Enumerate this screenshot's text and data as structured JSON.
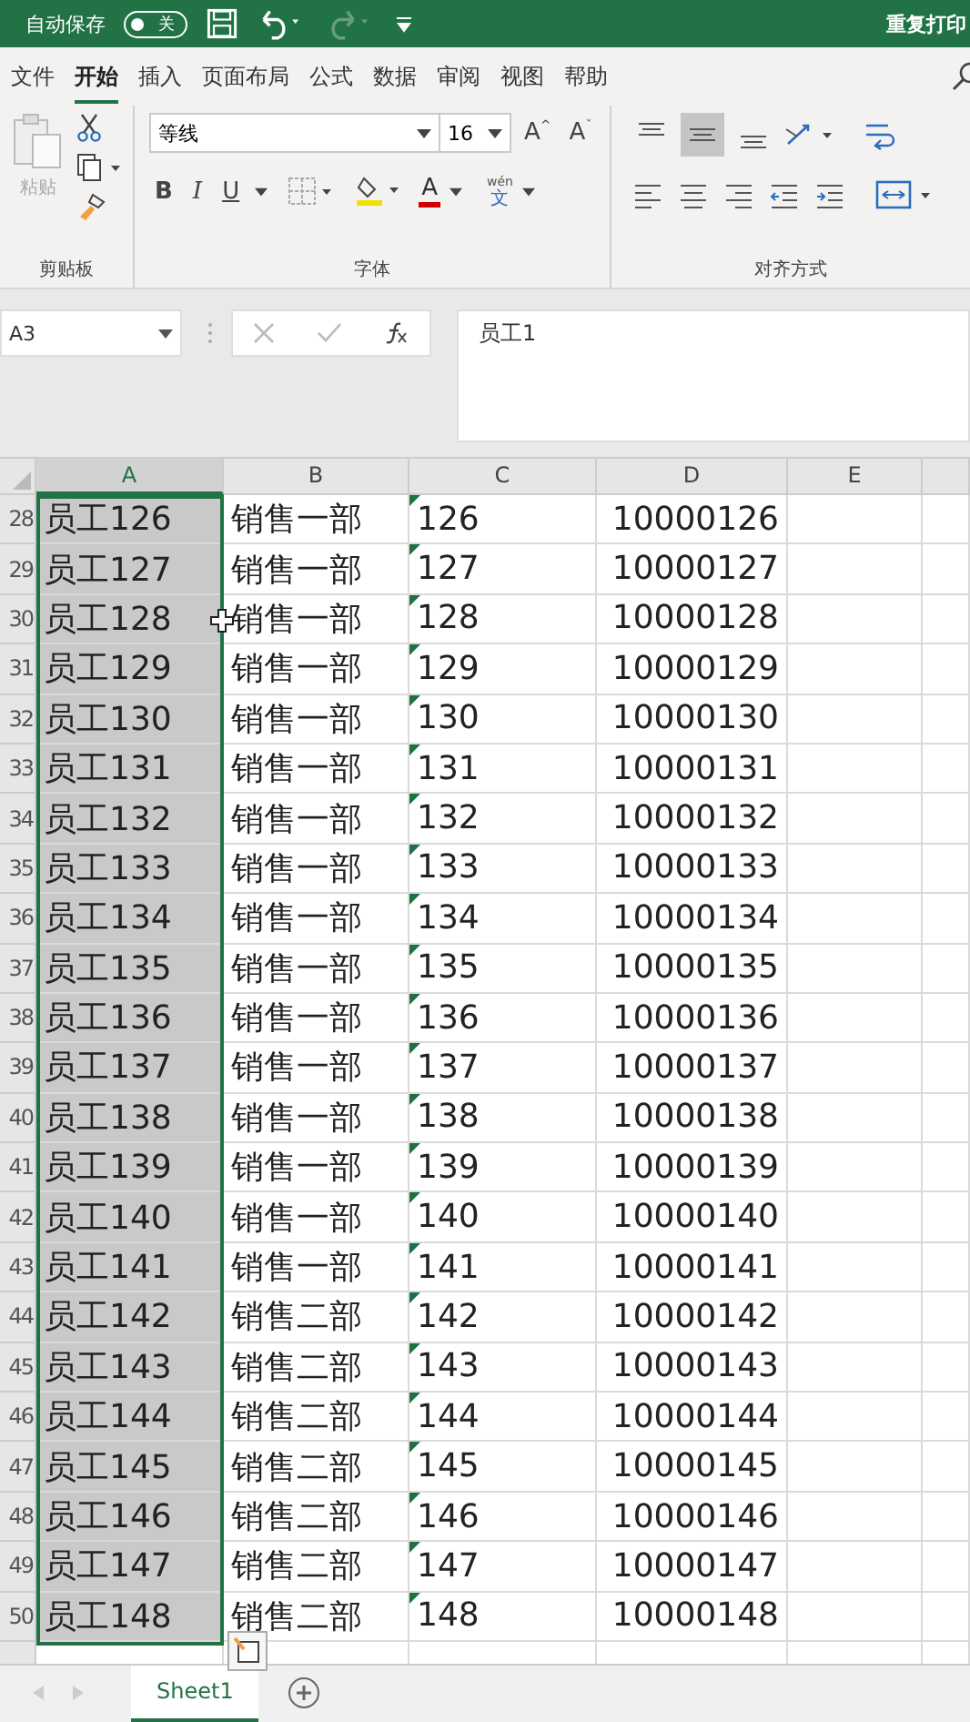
{
  "titlebar": {
    "autosave_label": "自动保存",
    "autosave_on": false,
    "autosave_state": "关",
    "title": "重复打印"
  },
  "tabs": [
    {
      "label": "文件",
      "selected": false
    },
    {
      "label": "开始",
      "selected": true
    },
    {
      "label": "插入",
      "selected": false
    },
    {
      "label": "页面布局",
      "selected": false
    },
    {
      "label": "公式",
      "selected": false
    },
    {
      "label": "数据",
      "selected": false
    },
    {
      "label": "审阅",
      "selected": false
    },
    {
      "label": "视图",
      "selected": false
    },
    {
      "label": "帮助",
      "selected": false
    }
  ],
  "ribbon": {
    "clipboard": {
      "paste_label": "粘贴",
      "group_label": "剪贴板"
    },
    "font": {
      "font_name": "等线",
      "font_size": "16",
      "grow": "A",
      "grow_mark": "^",
      "shrink": "A",
      "shrink_mark": "ˇ",
      "bold": "B",
      "italic": "I",
      "underline": "U",
      "font_color_glyph": "A",
      "phonetic_top": "wén",
      "phonetic_bottom": "文",
      "group_label": "字体"
    },
    "alignment": {
      "vertical": [
        {
          "kind": "top",
          "selected": false
        },
        {
          "kind": "middle",
          "selected": true
        },
        {
          "kind": "bottom",
          "selected": false
        }
      ],
      "group_label": "对齐方式"
    }
  },
  "formula_bar": {
    "name_box": "A3",
    "formula": "员工1"
  },
  "columns": [
    {
      "label": "A",
      "selected": true
    },
    {
      "label": "B",
      "selected": false
    },
    {
      "label": "C",
      "selected": false
    },
    {
      "label": "D",
      "selected": false
    },
    {
      "label": "E",
      "selected": false
    }
  ],
  "rows": [
    {
      "row": "28",
      "a": "员工126",
      "b": "销售一部",
      "c": "126",
      "d": "10000126"
    },
    {
      "row": "29",
      "a": "员工127",
      "b": "销售一部",
      "c": "127",
      "d": "10000127"
    },
    {
      "row": "30",
      "a": "员工128",
      "b": "销售一部",
      "c": "128",
      "d": "10000128"
    },
    {
      "row": "31",
      "a": "员工129",
      "b": "销售一部",
      "c": "129",
      "d": "10000129"
    },
    {
      "row": "32",
      "a": "员工130",
      "b": "销售一部",
      "c": "130",
      "d": "10000130"
    },
    {
      "row": "33",
      "a": "员工131",
      "b": "销售一部",
      "c": "131",
      "d": "10000131"
    },
    {
      "row": "34",
      "a": "员工132",
      "b": "销售一部",
      "c": "132",
      "d": "10000132"
    },
    {
      "row": "35",
      "a": "员工133",
      "b": "销售一部",
      "c": "133",
      "d": "10000133"
    },
    {
      "row": "36",
      "a": "员工134",
      "b": "销售一部",
      "c": "134",
      "d": "10000134"
    },
    {
      "row": "37",
      "a": "员工135",
      "b": "销售一部",
      "c": "135",
      "d": "10000135"
    },
    {
      "row": "38",
      "a": "员工136",
      "b": "销售一部",
      "c": "136",
      "d": "10000136"
    },
    {
      "row": "39",
      "a": "员工137",
      "b": "销售一部",
      "c": "137",
      "d": "10000137"
    },
    {
      "row": "40",
      "a": "员工138",
      "b": "销售一部",
      "c": "138",
      "d": "10000138"
    },
    {
      "row": "41",
      "a": "员工139",
      "b": "销售一部",
      "c": "139",
      "d": "10000139"
    },
    {
      "row": "42",
      "a": "员工140",
      "b": "销售一部",
      "c": "140",
      "d": "10000140"
    },
    {
      "row": "43",
      "a": "员工141",
      "b": "销售一部",
      "c": "141",
      "d": "10000141"
    },
    {
      "row": "44",
      "a": "员工142",
      "b": "销售二部",
      "c": "142",
      "d": "10000142"
    },
    {
      "row": "45",
      "a": "员工143",
      "b": "销售二部",
      "c": "143",
      "d": "10000143"
    },
    {
      "row": "46",
      "a": "员工144",
      "b": "销售二部",
      "c": "144",
      "d": "10000144"
    },
    {
      "row": "47",
      "a": "员工145",
      "b": "销售二部",
      "c": "145",
      "d": "10000145"
    },
    {
      "row": "48",
      "a": "员工146",
      "b": "销售二部",
      "c": "146",
      "d": "10000146"
    },
    {
      "row": "49",
      "a": "员工147",
      "b": "销售二部",
      "c": "147",
      "d": "10000147"
    },
    {
      "row": "50",
      "a": "员工148",
      "b": "销售二部",
      "c": "148",
      "d": "10000148"
    }
  ],
  "sheets": [
    {
      "label": "Sheet1",
      "selected": true
    }
  ]
}
